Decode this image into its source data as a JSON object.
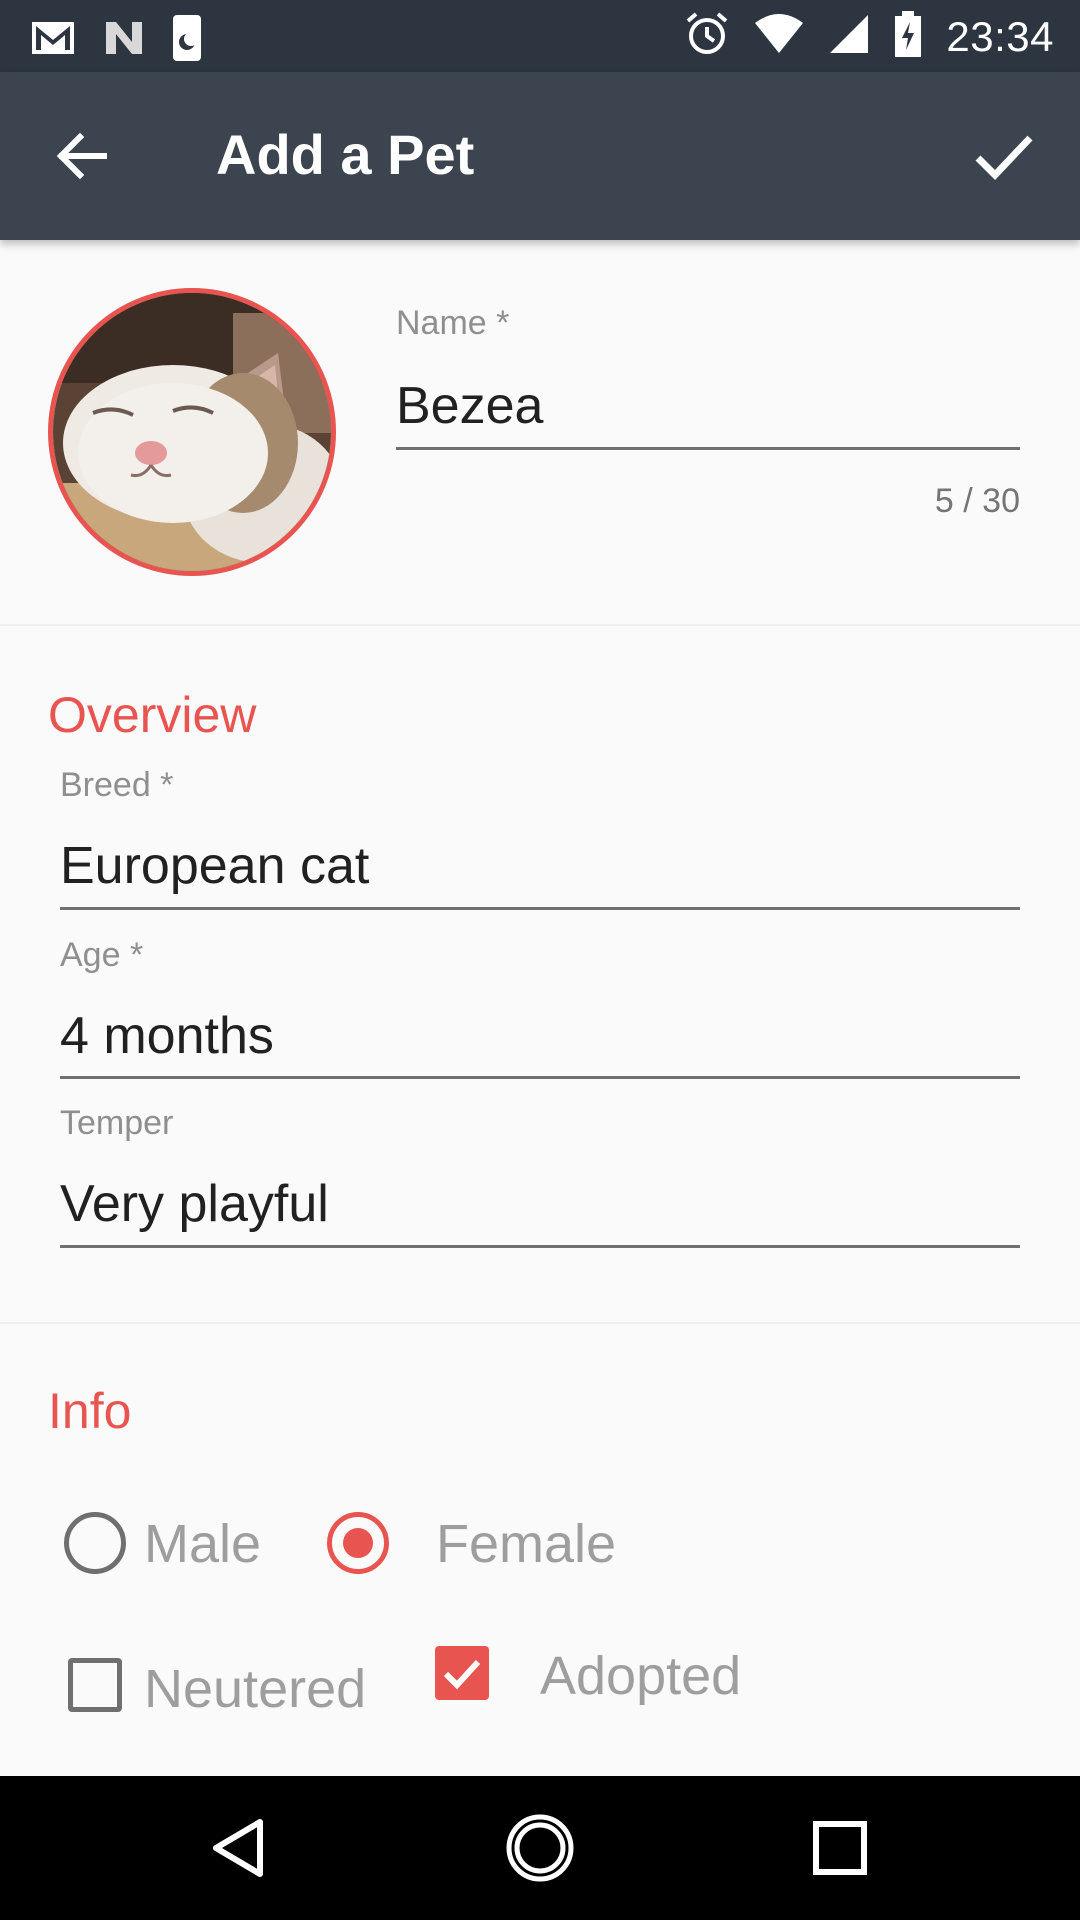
{
  "status_bar": {
    "time": "23:34",
    "left_icons": [
      "gmail-icon",
      "n-app-icon",
      "moon-app-icon"
    ],
    "right_icons": [
      "alarm-icon",
      "wifi-icon",
      "signal-icon",
      "battery-charging-icon"
    ]
  },
  "app_bar": {
    "title": "Add a Pet",
    "back_icon": "arrow-back-icon",
    "confirm_icon": "check-icon",
    "background": "#3c4450"
  },
  "pet_photo": {
    "description_icon": "cat-photo"
  },
  "name_field": {
    "label": "Name *",
    "value": "Bezea",
    "counter": "5 / 30"
  },
  "overview": {
    "title": "Overview",
    "breed": {
      "label": "Breed *",
      "value": "European cat"
    },
    "age": {
      "label": "Age *",
      "value": "4 months"
    },
    "temper": {
      "label": "Temper",
      "value": "Very playful"
    }
  },
  "info": {
    "title": "Info",
    "gender": {
      "male_label": "Male",
      "female_label": "Female",
      "selected": "Female"
    },
    "neutered": {
      "label": "Neutered",
      "checked": false
    },
    "adopted": {
      "label": "Adopted",
      "checked": true
    }
  },
  "nav_bar": {
    "icons": [
      "back-triangle-icon",
      "home-circle-icon",
      "recents-square-icon"
    ]
  },
  "colors": {
    "accent": "#e85450",
    "status_bar": "#2d3540",
    "app_bar": "#3c4450"
  }
}
